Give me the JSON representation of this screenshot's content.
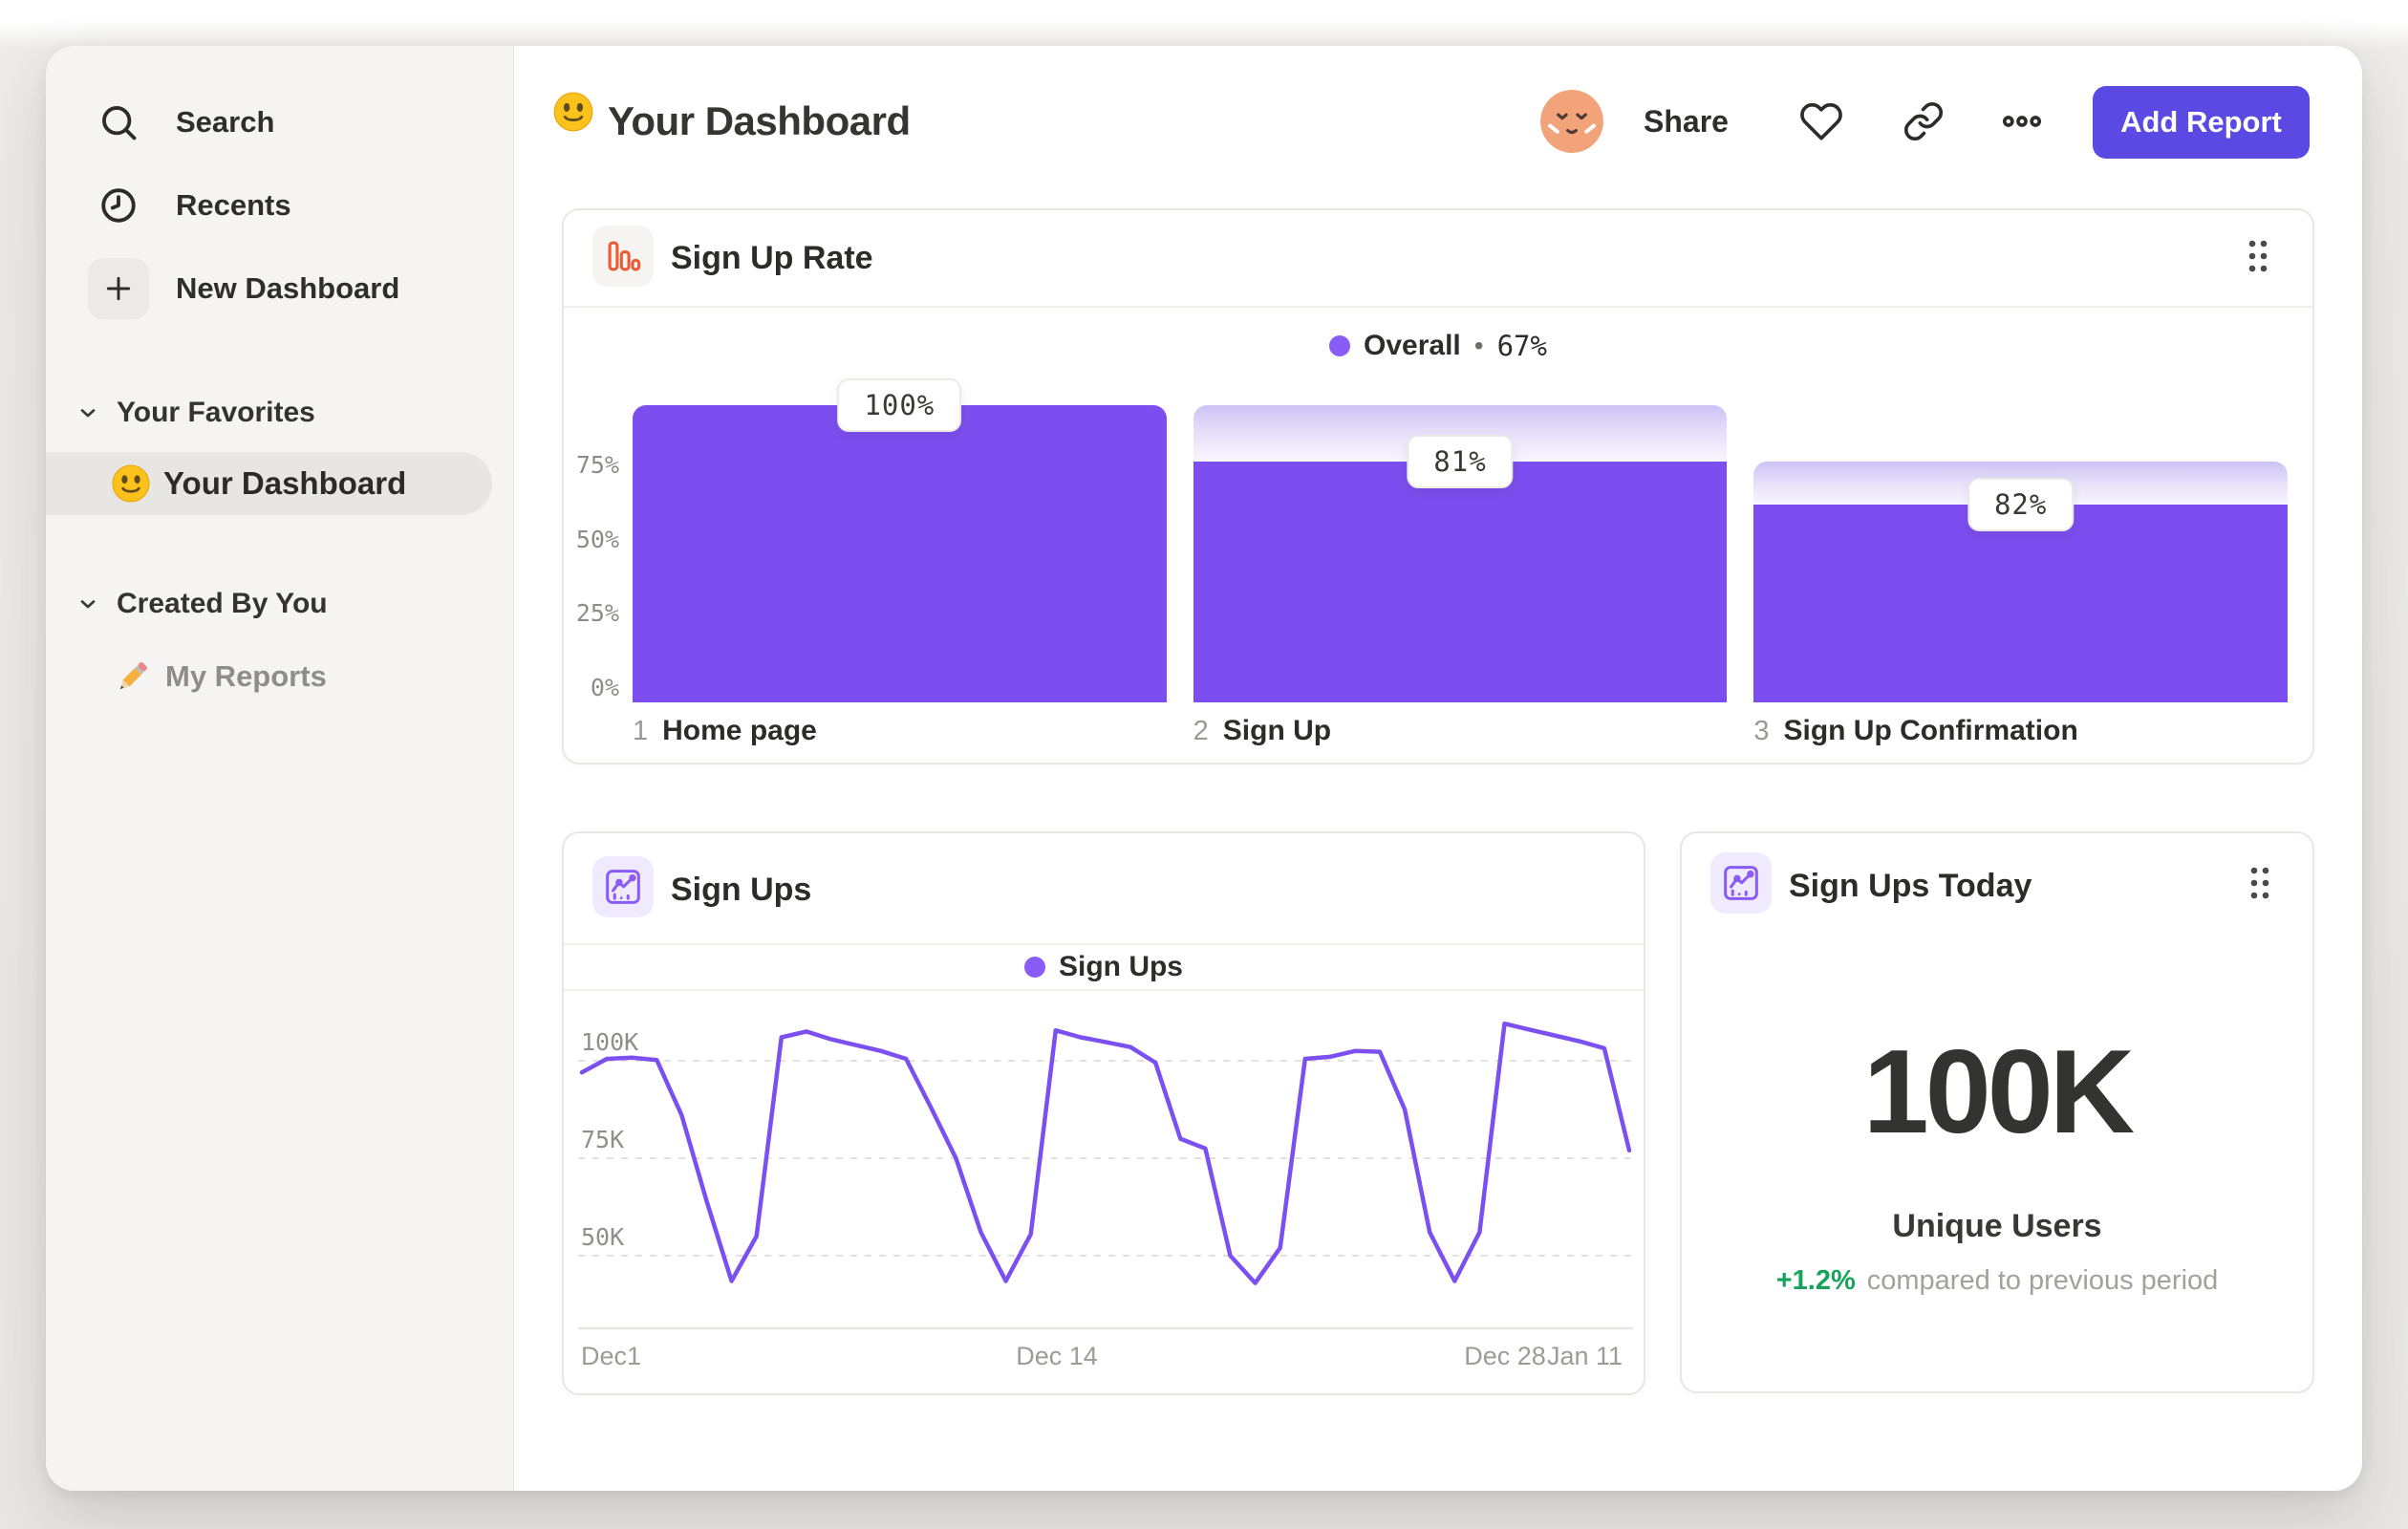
{
  "header": {
    "title": "Your Dashboard",
    "share_label": "Share",
    "add_report_label": "Add Report"
  },
  "sidebar": {
    "search_label": "Search",
    "recents_label": "Recents",
    "new_dashboard_label": "New Dashboard",
    "favorites_header": "Your Favorites",
    "favorites_items": [
      {
        "label": "Your Dashboard",
        "selected": true
      }
    ],
    "created_header": "Created By You",
    "created_items": [
      {
        "label": "My Reports"
      }
    ]
  },
  "kpi": {
    "title": "Sign Ups Today",
    "value": "100K",
    "label": "Unique Users",
    "delta": "+1.2%",
    "delta_note": "compared to previous period"
  },
  "icons": {
    "search": "magnifier",
    "recents": "clock",
    "new_dashboard": "plus",
    "section_toggle": "chevron-down",
    "favorite_item": "smiley-emoji",
    "report_item": "pencil-emoji",
    "title_prefix": "smiley-emoji",
    "user": "avatar-face",
    "favorite_action": "heart-outline",
    "copy_link": "link-chain",
    "more_actions": "three-dots",
    "card_drag": "six-dot-drag-handle",
    "funnel_card": "orange-bar-chart",
    "line_card": "purple-line-chart",
    "kpi_card": "purple-line-chart"
  },
  "colors": {
    "bar_purple": "#7c4eef",
    "legend_dot": "#8a5cf6",
    "button_purple": "#5a49e3",
    "icon_orange": "#ee5a33",
    "delta_green": "#17a35c",
    "sidebar_bg": "#f5f4f2",
    "selected_pill": "#e8e6e3",
    "ghost_top": "#cdc2f5",
    "ghost_bottom": "#f8f6fe"
  },
  "chart_data": [
    {
      "type": "bar",
      "variant": "funnel-steps",
      "title": "Sign Up Rate",
      "legend": {
        "series": "Overall",
        "separator": "•",
        "value": "67%"
      },
      "ylim": [
        0,
        100
      ],
      "y_ticks_pct": [
        75,
        50,
        25,
        0
      ],
      "steps": [
        {
          "num": "1",
          "label": "Home page",
          "step_conversion_pct": 100,
          "cumulative_pct": 100,
          "badge": "100%"
        },
        {
          "num": "2",
          "label": "Sign Up",
          "step_conversion_pct": 81,
          "cumulative_pct": 81,
          "badge": "81%"
        },
        {
          "num": "3",
          "label": "Sign Up Confirmation",
          "step_conversion_pct": 82,
          "cumulative_pct": 66.4,
          "badge": "82%"
        }
      ]
    },
    {
      "type": "line",
      "title": "Sign Ups",
      "legend": "Sign Ups",
      "x_tick_labels": [
        "Dec1",
        "Dec 14",
        "Dec 28",
        "Jan 11"
      ],
      "y_tick_labels": [
        "100K",
        "75K",
        "50K"
      ],
      "y_ticks_k": [
        100,
        75,
        50
      ],
      "unit": "thousands of sign ups per day, Dec 1 – Jan 12",
      "values_k": [
        97,
        100.5,
        100.8,
        100.2,
        86,
        64,
        43.5,
        55,
        106,
        107.5,
        105.5,
        104,
        102.5,
        100.5,
        88,
        75,
        56,
        43.5,
        55.5,
        107.8,
        106,
        104.8,
        103.5,
        99.5,
        80,
        77.5,
        50,
        43,
        52,
        100.5,
        101,
        102.5,
        102.3,
        87.5,
        56,
        43.5,
        56,
        109.5,
        108,
        106.5,
        105,
        103.2,
        77
      ]
    }
  ]
}
